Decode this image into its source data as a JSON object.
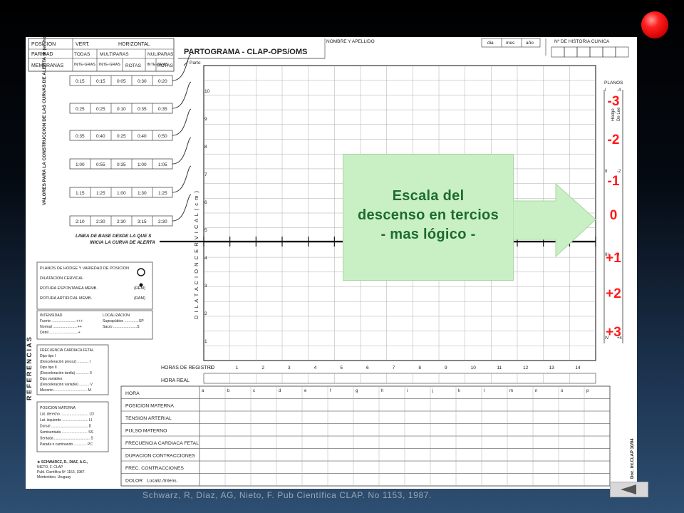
{
  "form": {
    "header_left": {
      "posicion": "POSICION",
      "paridad": "PARIDAD",
      "membranas": "MEMBRANAS",
      "vert": "VERT.",
      "horizontal": "HORIZONTAL",
      "todas": "TODAS",
      "multiparas": "MULTIPARAS",
      "nuliparas": "NULIPARAS",
      "inte_gras": "INTE-GRAS",
      "rotas": "ROTAS"
    },
    "title": "PARTOGRAMA  - CLAP-OPS/OMS",
    "nombre": "NOMBRE Y APELLIDO",
    "dia": "dia",
    "mes": "mes",
    "anio": "año",
    "historia": "Nº DE HISTORIA CLINICA",
    "alert_rows": [
      [
        "0:15",
        "0:15",
        "0:05",
        "0:30",
        "0:20"
      ],
      [
        "0:25",
        "0:25",
        "0:10",
        "0:35",
        "0:35"
      ],
      [
        "0:35",
        "0:40",
        "0:25",
        "0:40",
        "0:50"
      ],
      [
        "1:00",
        "0:55",
        "0:35",
        "1:00",
        "1:05"
      ],
      [
        "1:15",
        "1:25",
        "1:00",
        "1:30",
        "1:25"
      ],
      [
        "2:10",
        "2:30",
        "2:30",
        "3:15",
        "2:30"
      ]
    ],
    "alert_side_label": "VALORES PARA LA CONSTRUCCION DE LAS CURVAS DE ALERTA ★ (en horas) p10",
    "baseline_label": "LINEA DE BASE DESDE LA QUE SE INICIA LA CURVA DE ALERTA",
    "parto": "Parto",
    "dilatacion": "D I L A T A C I O N   C E R V I C A L   ( c m )",
    "y_ticks": [
      "1",
      "2",
      "3",
      "4",
      "5",
      "6",
      "7",
      "8",
      "9",
      "10"
    ],
    "planos": "PLANOS",
    "hodge": "Hodge",
    "de_lee": "De Lee",
    "planos_ticks": [
      "I",
      "II",
      "III",
      "IV"
    ],
    "de_lee_ticks": [
      "-4",
      "-2",
      "0",
      "+4"
    ],
    "horas_registro": "HORAS DE REGISTRO",
    "hora_real": "HORA REAL",
    "x_ticks": [
      "0",
      "1",
      "2",
      "3",
      "4",
      "5",
      "6",
      "7",
      "8",
      "9",
      "10",
      "11",
      "12",
      "13",
      "14"
    ],
    "letters": [
      "a",
      "b",
      "c",
      "d",
      "e",
      "f",
      "g",
      "h",
      "i",
      "j",
      "k",
      "l",
      "m",
      "n",
      "o",
      "p"
    ],
    "rows": [
      "HORA",
      "POSICION MATERNA",
      "TENSION ARTERIAL",
      "PULSO MATERNO",
      "FRECUENCIA CARDIACA FETAL",
      "DURACION CONTRACCIONES",
      "FREC. CONTRACCIONES",
      "DOLOR"
    ],
    "dolor_extra": "Localiz./Intens.",
    "referencias": "R E F E R E N C I A S",
    "ref_box1": [
      "PLANOS DE HODGE Y VARIEDAD DE POSICION",
      "DILATACION CERVICAL",
      "ROTURA ESPONTANEA MEMB.",
      "ROTURA ARTIFICIAL MEMB."
    ],
    "ref_box1_codes": [
      "",
      "",
      "(REM)",
      "(RAM)"
    ],
    "ref_intensidad": [
      "INTENSIDAD",
      "Fuerte ........................+++",
      "Normal ........................++",
      "Débil ............................+"
    ],
    "ref_localizacion": [
      "LOCALIZACION",
      "Suprapúbico ..............SP",
      "Sacro .......................S"
    ],
    "ref_fcf": [
      "FRECUENCIA CARDIACA FETAL",
      "Dips tipo I",
      "(Desceleración precoz) ........... I",
      "Dips tipo II",
      "(Desceleración tardía) ............. II",
      "Dips variables",
      "(Desceleración variable) .......... V",
      "Meconio ................................. M"
    ],
    "ref_posicion": [
      "POSICION MATERNA",
      "Lat. derecho ............................ LD",
      "Lat. izquierdo .......................... LI",
      "Dorsal ..................................... D",
      "Semisentada .......................... SS",
      "Sentada .................................... S",
      "Parada o caminando ............. PC"
    ],
    "ref_author": [
      "★ SCHWARCZ, R., DIAZ, A.G.,",
      "NIETO, F. CLAP",
      "Publ. Científica Nº 1153, 1987.",
      "Montevideo, Uruguay"
    ],
    "side_code": "Doc. Int.CLAP 10/04"
  },
  "overlay": {
    "scale_labels": [
      "-3",
      "-2",
      "-1",
      "0",
      "+1",
      "+2",
      "+3"
    ],
    "callout": [
      "Escala del",
      "descenso en tercios",
      "- mas lógico -"
    ],
    "citation": "Schwarz, R, Díaz, AG, Nieto, F. Pub Científica CLAP.  No 1153, 1987."
  },
  "colors": {
    "overlay_red": "#ff1a1a",
    "callout_green_bg": "#c9f0c5",
    "callout_text": "#1e6b2f"
  },
  "icons": [
    "red-dot-icon",
    "arrow-right-icon",
    "nav-back-icon"
  ]
}
